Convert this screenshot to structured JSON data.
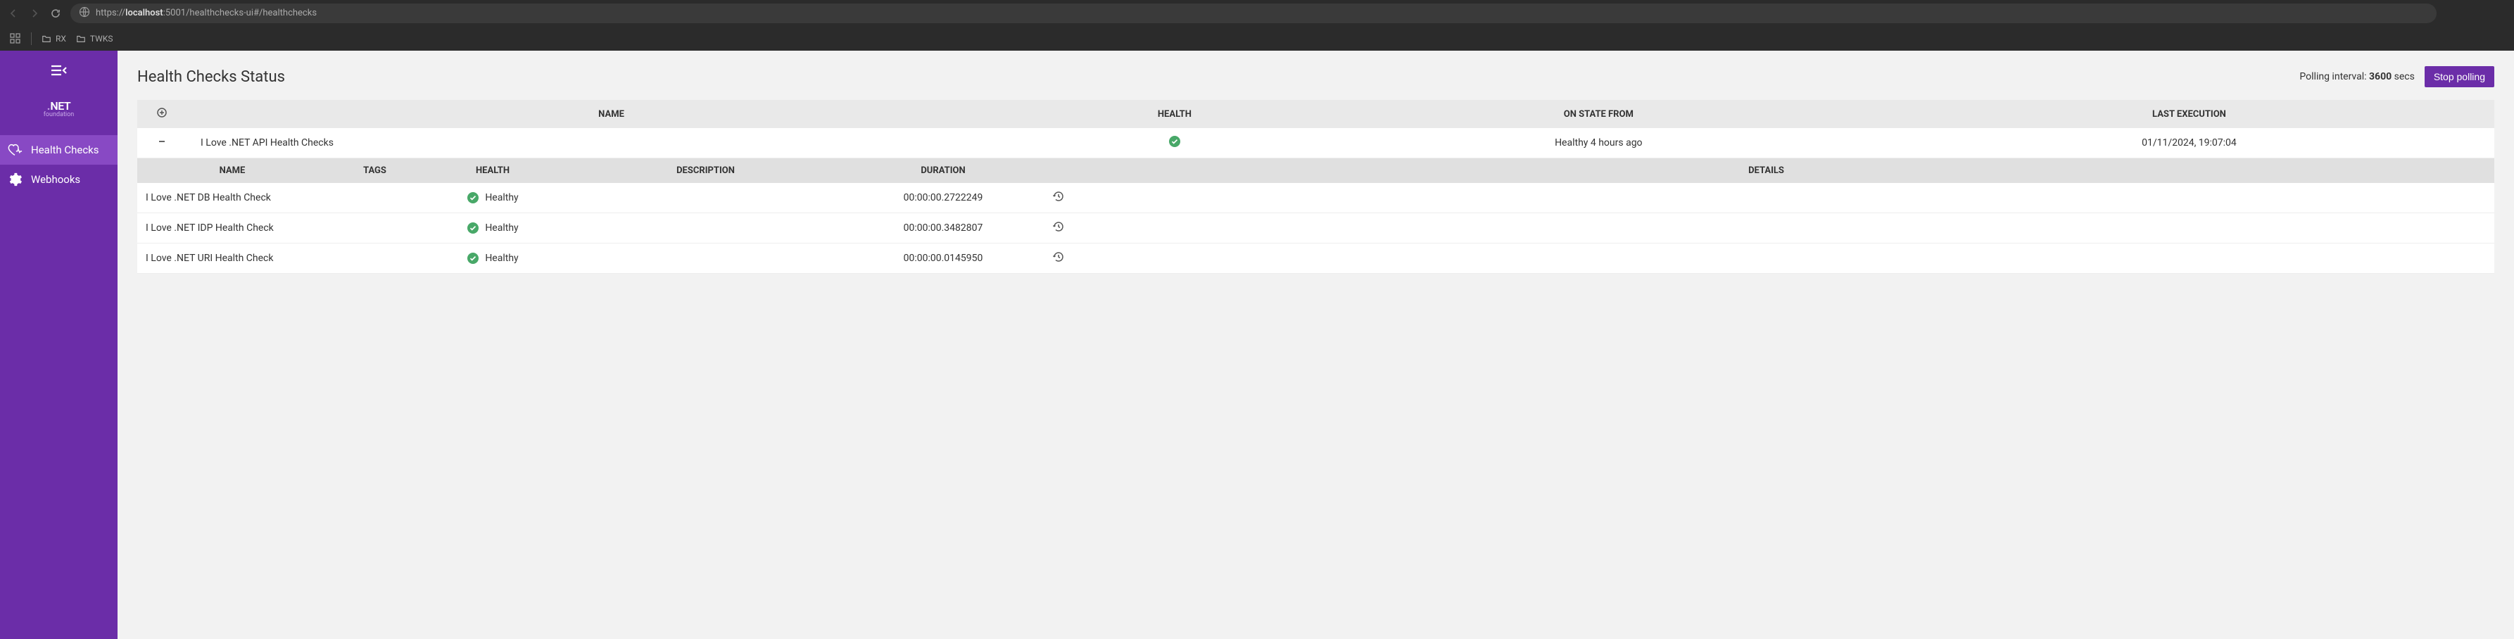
{
  "browser": {
    "url_prefix": "https://",
    "url_host": "localhost",
    "url_port": ":5001",
    "url_path": "/healthchecks-ui#/healthchecks",
    "bookmarks": [
      {
        "label": "RX"
      },
      {
        "label": "TWKS"
      }
    ]
  },
  "sidebar": {
    "logo_text": "NET",
    "logo_sub": "foundation",
    "items": [
      {
        "label": "Health Checks",
        "active": true
      },
      {
        "label": "Webhooks",
        "active": false
      }
    ]
  },
  "page": {
    "title": "Health Checks Status",
    "polling_prefix": "Polling interval: ",
    "polling_value": "3600",
    "polling_suffix": " secs",
    "stop_label": "Stop polling"
  },
  "main_table": {
    "headers": {
      "name": "NAME",
      "health": "HEALTH",
      "on_state": "ON STATE FROM",
      "last_exec": "LAST EXECUTION"
    },
    "row": {
      "name": "I Love .NET API Health Checks",
      "health_status": "Healthy",
      "on_state": "Healthy 4 hours ago",
      "last_exec": "01/11/2024, 19:07:04"
    }
  },
  "detail_table": {
    "headers": {
      "name": "NAME",
      "tags": "TAGS",
      "health": "HEALTH",
      "description": "DESCRIPTION",
      "duration": "DURATION",
      "details": "DETAILS"
    },
    "rows": [
      {
        "name": "I Love .NET DB Health Check",
        "tags": "",
        "health": "Healthy",
        "description": "",
        "duration": "00:00:00.2722249"
      },
      {
        "name": "I Love .NET IDP Health Check",
        "tags": "",
        "health": "Healthy",
        "description": "",
        "duration": "00:00:00.3482807"
      },
      {
        "name": "I Love .NET URI Health Check",
        "tags": "",
        "health": "Healthy",
        "description": "",
        "duration": "00:00:00.0145950"
      }
    ]
  },
  "colors": {
    "healthy": "#48a868"
  }
}
